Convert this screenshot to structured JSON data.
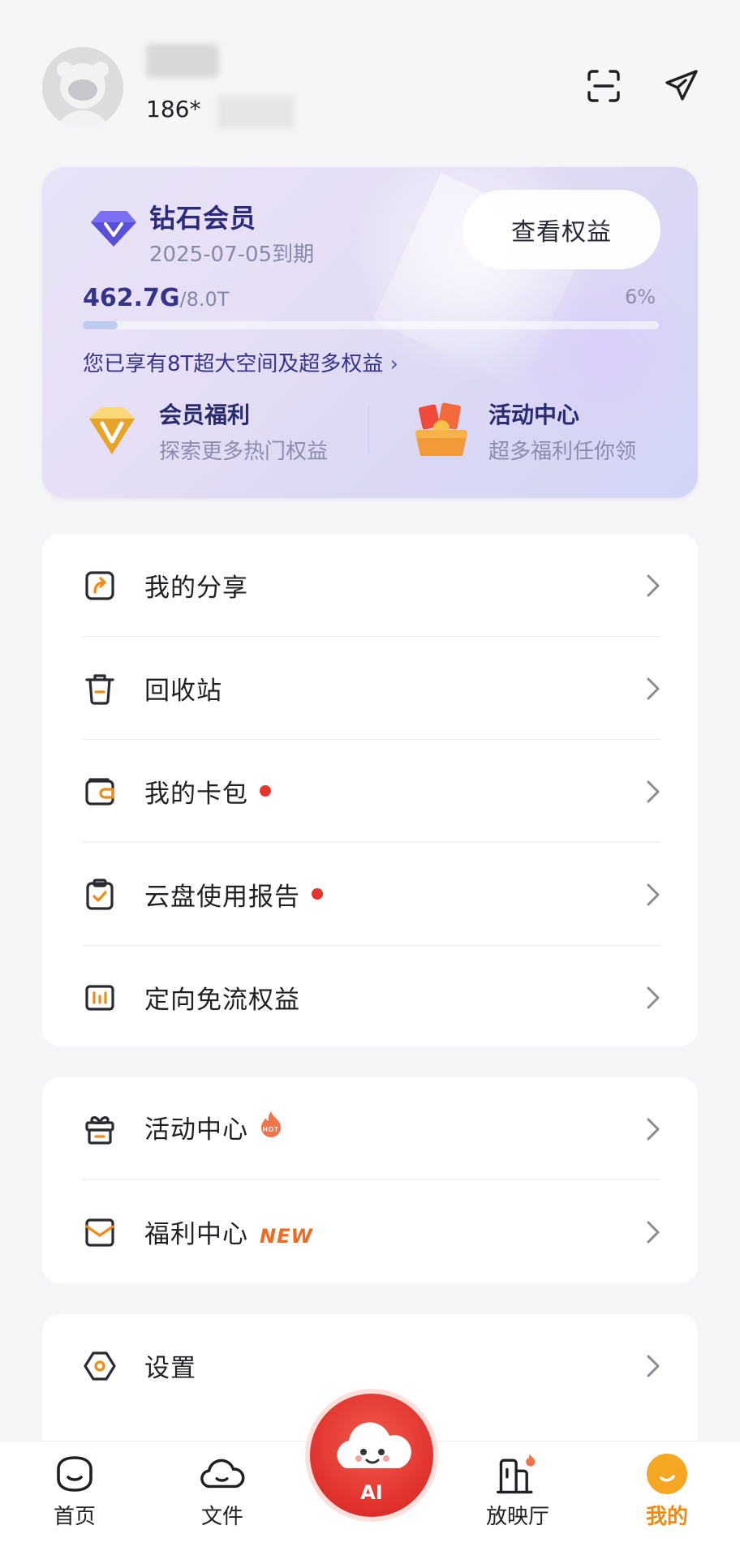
{
  "header": {
    "phone_prefix": "186*"
  },
  "member_card": {
    "tier": "钻石会员",
    "expire": "2025-07-05到期",
    "rights_button": "查看权益",
    "used": "462.7G",
    "total": "/8.0T",
    "percent_label": "6%",
    "percent": 0.06,
    "promo": "您已享有8T超大空间及超多权益",
    "promo_chevron": "›",
    "benefits": [
      {
        "title": "会员福利",
        "subtitle": "探索更多热门权益"
      },
      {
        "title": "活动中心",
        "subtitle": "超多福利任你领"
      }
    ]
  },
  "menu": {
    "group1": [
      {
        "label": "我的分享",
        "icon": "share-icon"
      },
      {
        "label": "回收站",
        "icon": "trash-icon"
      },
      {
        "label": "我的卡包",
        "icon": "wallet-icon",
        "dot": true
      },
      {
        "label": "云盘使用报告",
        "icon": "report-icon",
        "dot": true
      },
      {
        "label": "定向免流权益",
        "icon": "data-plan-icon"
      }
    ],
    "group2": [
      {
        "label": "活动中心",
        "icon": "gift-icon",
        "badge": "HOT"
      },
      {
        "label": "福利中心",
        "icon": "envelope-icon",
        "badge": "NEW"
      }
    ],
    "group3": [
      {
        "label": "设置",
        "icon": "settings-icon"
      }
    ]
  },
  "nav": {
    "items": [
      {
        "label": "首页",
        "icon": "home-icon"
      },
      {
        "label": "文件",
        "icon": "cloud-icon"
      },
      {
        "label": "AI",
        "icon": "ai-assistant-icon"
      },
      {
        "label": "放映厅",
        "icon": "theater-icon"
      },
      {
        "label": "我的",
        "icon": "profile-icon"
      }
    ],
    "active": "我的"
  },
  "colors": {
    "accent": "#f08a12",
    "tier_text": "#2c2a7a",
    "red_dot": "#e5352e",
    "ai_red": "#e0302c"
  }
}
